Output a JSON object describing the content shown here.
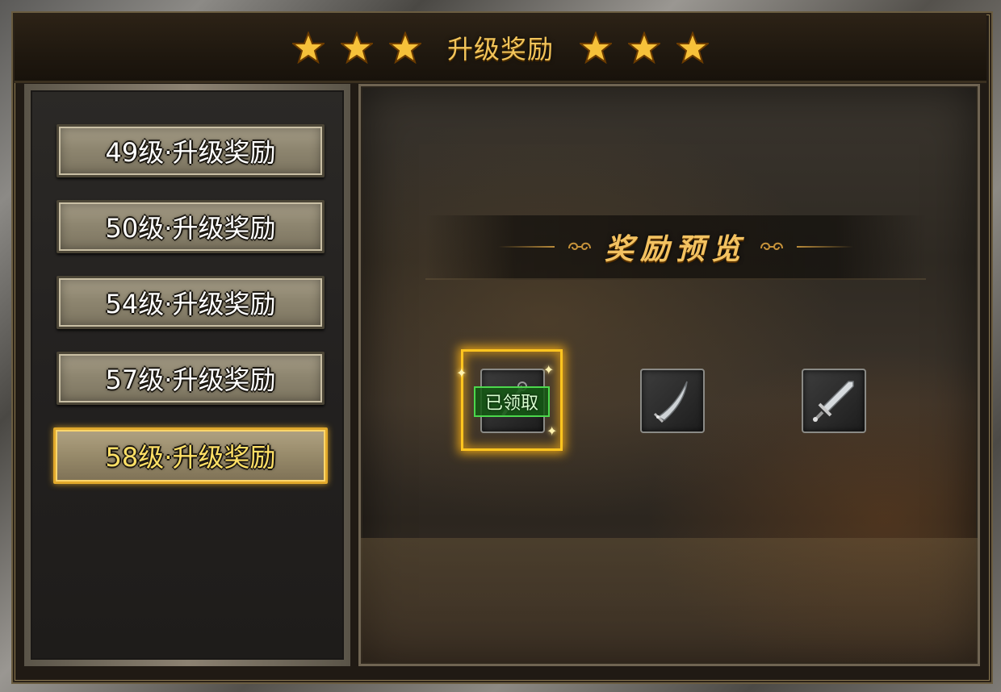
{
  "window": {
    "title": "升级奖励"
  },
  "level_list": [
    {
      "label": "49级·升级奖励",
      "selected": false
    },
    {
      "label": "50级·升级奖励",
      "selected": false
    },
    {
      "label": "54级·升级奖励",
      "selected": false
    },
    {
      "label": "57级·升级奖励",
      "selected": false
    },
    {
      "label": "58级·升级奖励",
      "selected": true
    }
  ],
  "preview": {
    "title": "奖励预览",
    "items": [
      {
        "icon": "mystery-item-icon",
        "status": "已领取",
        "claimed": true
      },
      {
        "icon": "curved-blade-icon",
        "claimed": false
      },
      {
        "icon": "sword-icon",
        "claimed": false
      }
    ]
  },
  "colors": {
    "title_gold": "#f2c45a",
    "active_border": "#e1a92c",
    "claimed_green": "#4cd84c"
  }
}
